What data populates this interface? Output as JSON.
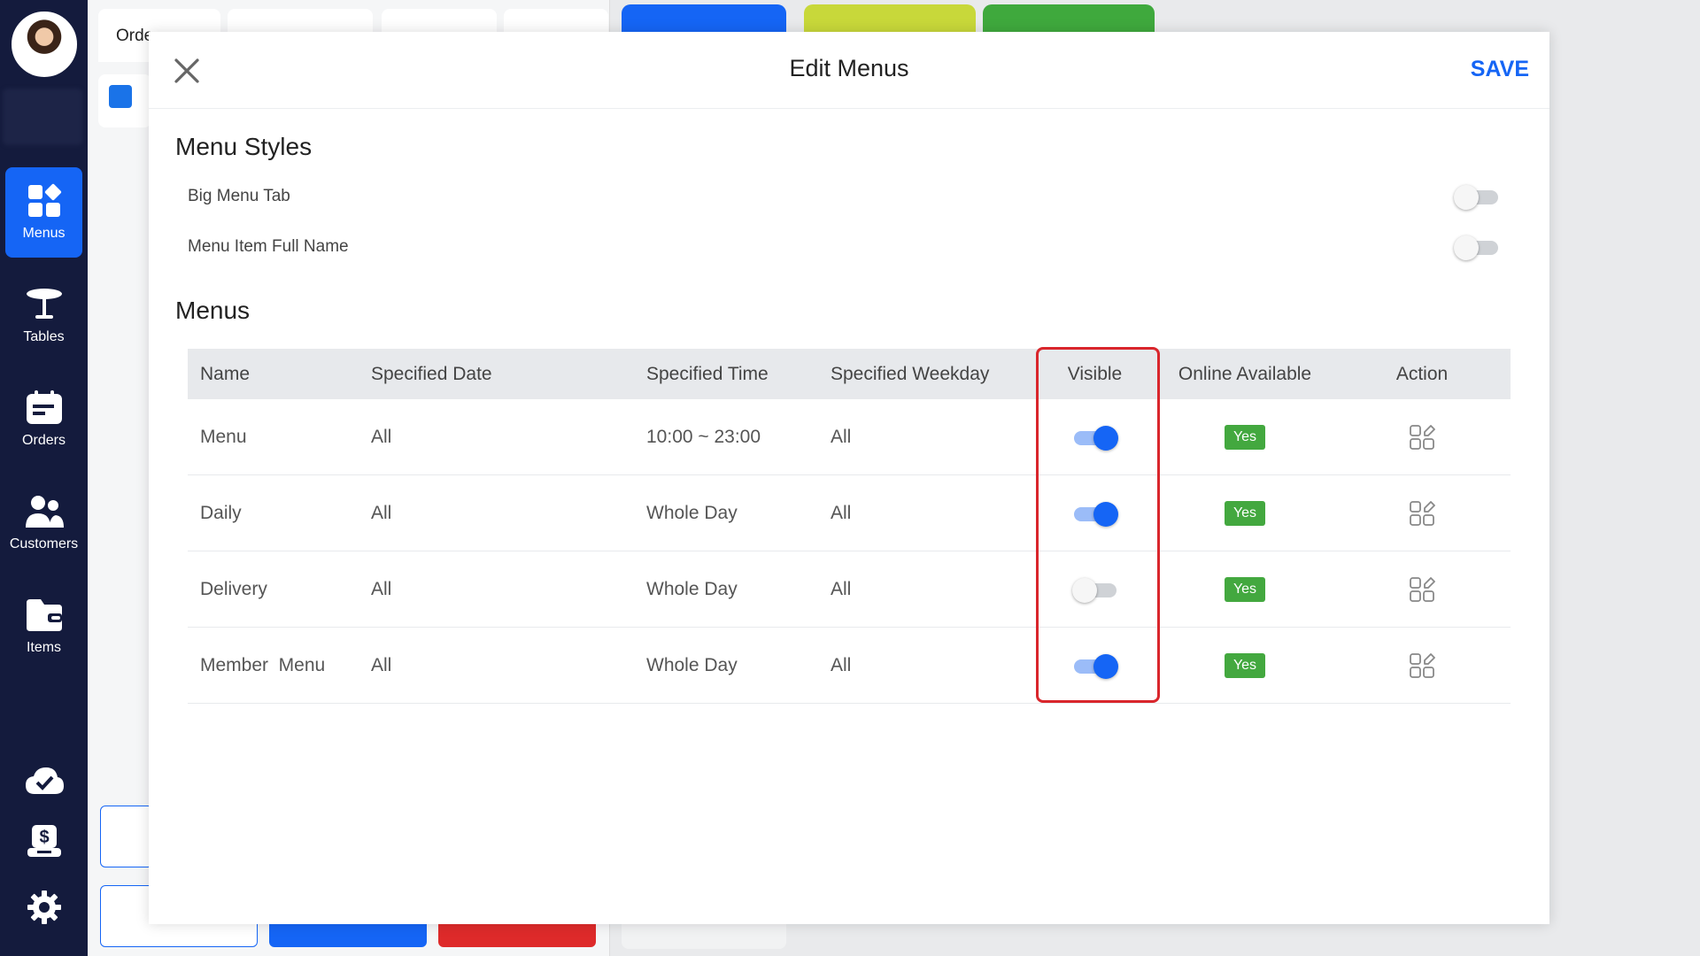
{
  "sidebar": {
    "items": [
      {
        "label": "Menus",
        "icon": "grid-icon",
        "active": true
      },
      {
        "label": "Tables",
        "icon": "table-icon",
        "active": false
      },
      {
        "label": "Orders",
        "icon": "orders-icon",
        "active": false
      },
      {
        "label": "Customers",
        "icon": "customers-icon",
        "active": false
      },
      {
        "label": "Items",
        "icon": "wallet-icon",
        "active": false
      }
    ],
    "bottom_icons": [
      "cloud-check-icon",
      "cash-register-icon",
      "gear-icon"
    ]
  },
  "background": {
    "order_tab_label": "Orde"
  },
  "modal": {
    "title": "Edit Menus",
    "save_label": "SAVE",
    "styles_section": {
      "title": "Menu Styles",
      "options": [
        {
          "label": "Big Menu Tab",
          "enabled": false
        },
        {
          "label": "Menu Item Full Name",
          "enabled": false
        }
      ]
    },
    "menus_section": {
      "title": "Menus",
      "columns": [
        "Name",
        "Specified Date",
        "Specified Time",
        "Specified Weekday",
        "Visible",
        "Online Available",
        "Action"
      ],
      "rows": [
        {
          "name": "Menu",
          "date": "All",
          "time": "10:00 ~ 23:00",
          "weekday": "All",
          "visible": true,
          "online": "Yes"
        },
        {
          "name": "Daily",
          "date": "All",
          "time": "Whole Day",
          "weekday": "All",
          "visible": true,
          "online": "Yes"
        },
        {
          "name": "Delivery",
          "date": "All",
          "time": "Whole Day",
          "weekday": "All",
          "visible": false,
          "online": "Yes"
        },
        {
          "name": "Member  Menu",
          "date": "All",
          "time": "Whole Day",
          "weekday": "All",
          "visible": true,
          "online": "Yes"
        }
      ]
    }
  },
  "colors": {
    "sidebar_bg": "#141b3d",
    "accent": "#1565f5",
    "yes_badge": "#43a83f",
    "highlight": "#d9262c"
  }
}
